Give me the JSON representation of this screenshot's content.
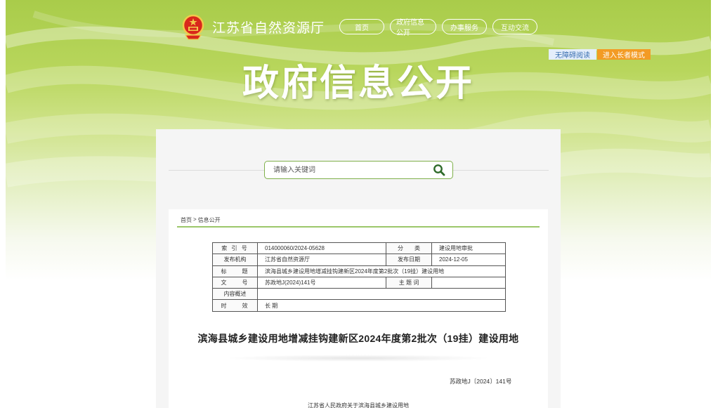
{
  "site": {
    "name": "江苏省自然资源厅",
    "hero_title": "政府信息公开"
  },
  "nav": {
    "items": [
      {
        "label": "首页"
      },
      {
        "label": "政府信息公开"
      },
      {
        "label": "办事服务"
      },
      {
        "label": "互动交流"
      }
    ]
  },
  "accessibility": {
    "barrier_free_label": "无障碍阅读",
    "elder_mode_label": "进入长者模式"
  },
  "search": {
    "placeholder": "请输入关键词",
    "icon": "search-icon"
  },
  "breadcrumb": {
    "home": "首页",
    "separator": ">",
    "current": "信息公开"
  },
  "meta": {
    "index_label": "索 引 号",
    "index_value": "014000060/2024-05628",
    "category_label": "分　　类",
    "category_value": "建设用地审批",
    "publisher_label": "发布机构",
    "publisher_value": "江苏省自然资源厅",
    "date_label": "发布日期",
    "date_value": "2024-12-05",
    "title_label": "标　　题",
    "title_value": "滨海县城乡建设用地增减挂钩建新区2024年度第2批次（19挂）建设用地",
    "docno_label": "文　　号",
    "docno_value": "苏政地J(2024)141号",
    "keywords_label": "主 题 词",
    "keywords_value": "",
    "summary_label": "内容概述",
    "summary_value": "",
    "validity_label": "时　　效",
    "validity_value": "长 期"
  },
  "document": {
    "title": "滨海县城乡建设用地增减挂钩建新区2024年度第2批次（19挂）建设用地",
    "number": "苏政地J〔2024〕141号",
    "subtitle": "江苏省人民政府关于滨海县城乡建设用地"
  },
  "colors": {
    "header_green": "#a9cc4a",
    "accent_green": "#7fb04a",
    "elder_orange": "#f39b24",
    "access_blue": "#e4eefb"
  }
}
